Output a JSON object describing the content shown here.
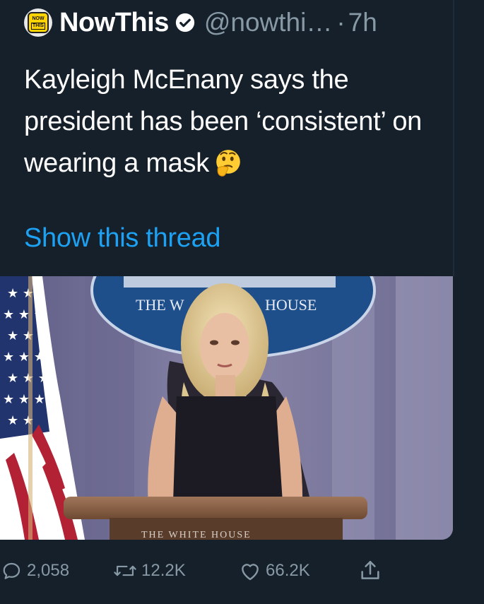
{
  "tweet": {
    "author_name": "NowThis",
    "handle": "@nowthi…",
    "separator": "·",
    "time": "7h",
    "avatar": {
      "top_word": "NOW",
      "bottom_word": "THIS"
    },
    "text": "Kayleigh McEnany says the president has been ‘consistent’ on wearing a mask",
    "emoji": "thinking-face",
    "thread_link": "Show this thread",
    "media": {
      "seal_text_left": "THE W",
      "seal_text_right": "HOUSE",
      "podium_text": "THE WHITE HOUSE"
    },
    "actions": {
      "replies": "2,058",
      "retweets": "12.2K",
      "likes": "66.2K"
    }
  },
  "colors": {
    "background": "#15202b",
    "text": "#ffffff",
    "muted": "#8899a6",
    "link": "#1da1f2"
  }
}
